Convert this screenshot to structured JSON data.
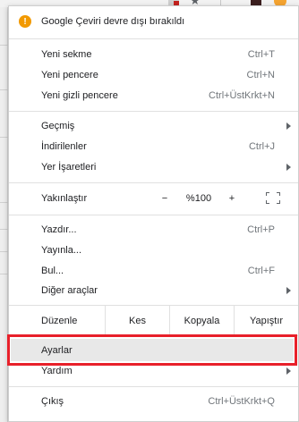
{
  "colors": {
    "accent_warning": "#f29900",
    "highlight_border": "#e8202a",
    "hover_bg": "#e8e8e8"
  },
  "toolbar": {
    "icons": [
      "extension-icon",
      "star-icon",
      "separator",
      "dark-extension-icon",
      "profile-icon"
    ]
  },
  "menu": {
    "notice": {
      "icon": "warning-icon",
      "icon_glyph": "!",
      "label": "Google Çeviri devre dışı bırakıldı"
    },
    "group1": [
      {
        "label": "Yeni sekme",
        "shortcut": "Ctrl+T"
      },
      {
        "label": "Yeni pencere",
        "shortcut": "Ctrl+N"
      },
      {
        "label": "Yeni gizli pencere",
        "shortcut": "Ctrl+ÜstKrkt+N"
      }
    ],
    "group2": [
      {
        "label": "Geçmiş",
        "shortcut": ""
      },
      {
        "label": "İndirilenler",
        "shortcut": "Ctrl+J"
      },
      {
        "label": "Yer İşaretleri",
        "shortcut": ""
      }
    ],
    "zoom": {
      "label": "Yakınlaştır",
      "minus": "−",
      "value": "%100",
      "plus": "+",
      "fullscreen_icon": "fullscreen-icon"
    },
    "group3": [
      {
        "label": "Yazdır...",
        "shortcut": "Ctrl+P"
      },
      {
        "label": "Yayınla...",
        "shortcut": ""
      },
      {
        "label": "Bul...",
        "shortcut": "Ctrl+F"
      },
      {
        "label": "Diğer araçlar",
        "shortcut": ""
      }
    ],
    "edit": {
      "label": "Düzenle",
      "cut": "Kes",
      "copy": "Kopyala",
      "paste": "Yapıştır"
    },
    "group4": [
      {
        "label": "Ayarlar",
        "shortcut": ""
      },
      {
        "label": "Yardım",
        "shortcut": ""
      }
    ],
    "exit": {
      "label": "Çıkış",
      "shortcut": "Ctrl+ÜstKrkt+Q"
    }
  }
}
